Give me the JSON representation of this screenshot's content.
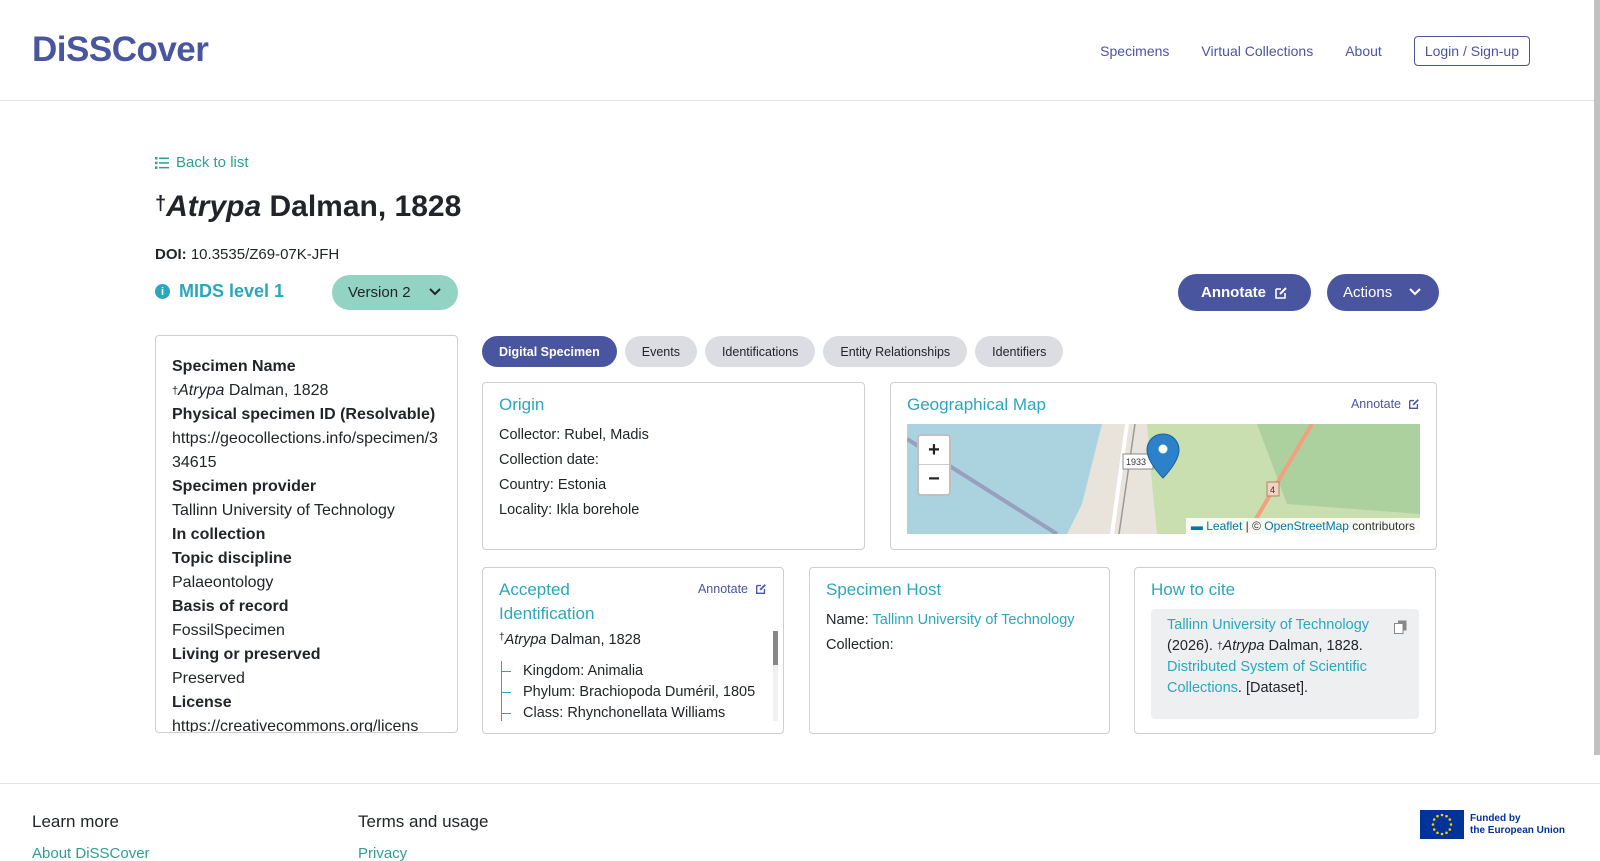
{
  "header": {
    "brand": "DiSSCover",
    "nav": [
      "Specimens",
      "Virtual Collections",
      "About"
    ],
    "login": "Login / Sign-up"
  },
  "back": "Back to list",
  "title": {
    "dagger": "†",
    "genus": "Atrypa",
    "author": "Dalman, 1828"
  },
  "doi": {
    "label": "DOI:",
    "value": "10.3535/Z69-07K-JFH"
  },
  "mids": "MIDS level 1",
  "version": "Version 2",
  "buttons": {
    "annotate": "Annotate",
    "actions": "Actions"
  },
  "left_panel": {
    "specimen_name_label": "Specimen Name",
    "specimen_name_dagger": "†",
    "specimen_name_genus": "Atrypa",
    "specimen_name_author": " Dalman, 1828",
    "physical_id_label": "Physical specimen ID (Resolvable)",
    "physical_id_value": "https://geocollections.info/specimen/334615",
    "provider_label": "Specimen provider",
    "provider_value": "Tallinn University of Technology",
    "in_collection_label": "In collection",
    "topic_label": "Topic discipline",
    "topic_value": "Palaeontology",
    "basis_label": "Basis of record",
    "basis_value": "FossilSpecimen",
    "living_label": "Living or preserved",
    "living_value": "Preserved",
    "license_label": "License",
    "license_value": "https://creativecommons.org/licens"
  },
  "tabs": [
    "Digital Specimen",
    "Events",
    "Identifications",
    "Entity Relationships",
    "Identifiers"
  ],
  "origin": {
    "title": "Origin",
    "collector_label": "Collector:",
    "collector_value": " Rubel, Madis",
    "date_label": "Collection date:",
    "country_label": "Country:",
    "country_value": " Estonia",
    "locality_label": "Locality:",
    "locality_value": " Ikla borehole"
  },
  "geo": {
    "title": "Geographical Map",
    "annotate": "Annotate",
    "zoom_in": "+",
    "zoom_out": "−",
    "road_label_1": "1933",
    "road_label_2": "4",
    "attr_leaflet": "Leaflet",
    "attr_sep": " | © ",
    "attr_osm": "OpenStreetMap",
    "attr_contrib": " contributors"
  },
  "accepted": {
    "title": "Accepted Identification",
    "annotate": "Annotate",
    "dagger": "†",
    "genus": "Atrypa",
    "author": " Dalman, 1828",
    "kingdom_label": "Kingdom:",
    "kingdom_value": " Animalia",
    "phylum_label": "Phylum:",
    "phylum_value": " Brachiopoda Duméril, 1805",
    "class_label": "Class:",
    "class_value": " Rhynchonellata Williams"
  },
  "host": {
    "title": "Specimen Host",
    "name_label": "Name:",
    "name_value": "Tallinn University of Technology",
    "collection_label": "Collection:"
  },
  "cite": {
    "title": "How to cite",
    "part1": "Tallinn University of Technology",
    "part2": " (2026). ",
    "dagger": "†",
    "genus": "Atrypa",
    "part3": " Dalman, 1828. ",
    "part4": "Distributed System of Scientific Collections",
    "part5": ". [Dataset]."
  },
  "footer": {
    "learn_more": "Learn more",
    "about": "About DiSSCover",
    "terms": "Terms and usage",
    "privacy": "Privacy",
    "eu_line1": "Funded by",
    "eu_line2": "the European Union"
  },
  "colors": {
    "primary": "#4a55a0",
    "accent": "#2aa7be",
    "teal": "#2e9e95",
    "version_bg": "#93d3c4"
  }
}
